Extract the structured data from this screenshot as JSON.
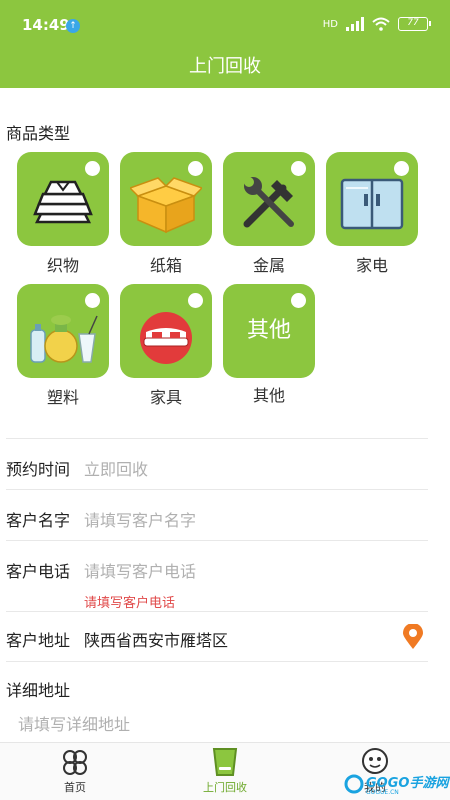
{
  "status_bar": {
    "time": "14:49",
    "network": "HD",
    "battery": "77"
  },
  "header": {
    "title": "上门回收"
  },
  "category": {
    "label": "商品类型",
    "items": [
      {
        "label": "织物",
        "icon": "folded-clothes-icon"
      },
      {
        "label": "纸箱",
        "icon": "cardboard-box-icon"
      },
      {
        "label": "金属",
        "icon": "hammer-wrench-icon"
      },
      {
        "label": "家电",
        "icon": "refrigerator-icon"
      },
      {
        "label": "塑料",
        "icon": "plastic-bottles-icon"
      },
      {
        "label": "家具",
        "icon": "sofa-icon"
      },
      {
        "label": "其他",
        "tile_text": "其他"
      }
    ]
  },
  "form": {
    "time": {
      "label": "预约时间",
      "value": "立即回收"
    },
    "name": {
      "label": "客户名字",
      "placeholder": "请填写客户名字"
    },
    "phone": {
      "label": "客户电话",
      "placeholder": "请填写客户电话",
      "error": "请填写客户电话"
    },
    "address": {
      "label": "客户地址",
      "value": "陕西省西安市雁塔区",
      "icon": "location-pin-icon"
    },
    "detail": {
      "label": "详细地址",
      "placeholder": "请填写详细地址"
    }
  },
  "tabbar": {
    "items": [
      {
        "label": "首页",
        "icon": "clover-icon"
      },
      {
        "label": "上门回收",
        "icon": "recycle-bin-icon",
        "active": true
      },
      {
        "label": "我的",
        "icon": "smiley-face-icon"
      }
    ]
  },
  "watermark": {
    "text": "GOGO手游网",
    "sub": "GOGUE.CN"
  },
  "colors": {
    "accent": "#8cc63f",
    "error": "#e04a4a",
    "placeholder": "#b0b0b0"
  }
}
